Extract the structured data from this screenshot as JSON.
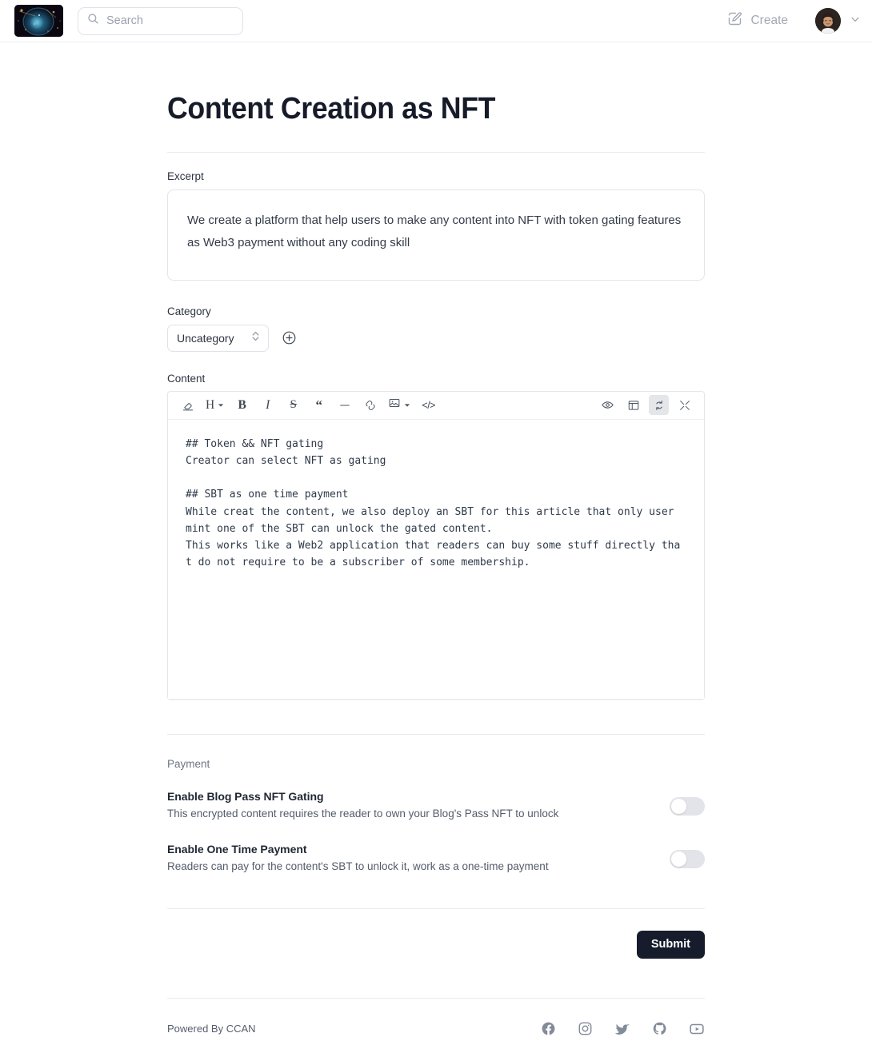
{
  "header": {
    "logo_icon": "nebula-logo-image",
    "search": {
      "placeholder": "Search",
      "value": "",
      "icon": "search-icon"
    },
    "create_label": "Create",
    "create_icon": "pencil-square-icon",
    "avatar_icon": "user-avatar-image",
    "user_chevron_icon": "chevron-down-icon"
  },
  "main": {
    "title": "Content Creation as NFT",
    "excerpt": {
      "label": "Excerpt",
      "value": "We create a platform that help users to make any content into NFT with token gating features as Web3 payment without any coding skill",
      "placeholder": "Excerpt"
    },
    "category": {
      "label": "Category",
      "selected": "Uncategory",
      "options": [
        "Uncategory"
      ],
      "stepper_icon": "chevron-up-down-icon",
      "add_icon": "plus-circle-icon"
    },
    "content": {
      "label": "Content",
      "value": "## Token && NFT gating\nCreator can select NFT as gating\n\n## SBT as one time payment\nWhile creat the content, we also deploy an SBT for this article that only user mint one of the SBT can unlock the gated content.\nThis works like a Web2 application that readers can buy some stuff directly that do not require to be a subscriber of some membership.",
      "toolbar_left": [
        {
          "name": "clear-format-icon",
          "label": "",
          "icon": "eraser-icon"
        },
        {
          "name": "heading-dropdown",
          "label": "H",
          "icon": "caret-down-icon"
        },
        {
          "name": "bold-button",
          "label": "B",
          "icon": ""
        },
        {
          "name": "italic-button",
          "label": "I",
          "icon": ""
        },
        {
          "name": "strikethrough-button",
          "label": "S",
          "icon": ""
        },
        {
          "name": "quote-button",
          "label": "“",
          "icon": ""
        },
        {
          "name": "horizontal-rule-button",
          "label": "",
          "icon": "minus-icon"
        },
        {
          "name": "link-button",
          "label": "",
          "icon": "link-icon"
        },
        {
          "name": "image-dropdown",
          "label": "",
          "icon": "image-icon"
        },
        {
          "name": "code-button",
          "label": "</>",
          "icon": ""
        }
      ],
      "toolbar_right": [
        {
          "name": "preview-toggle",
          "icon": "eye-icon",
          "active": false
        },
        {
          "name": "split-view-toggle",
          "icon": "side-panel-icon",
          "active": false
        },
        {
          "name": "sync-scroll-toggle",
          "icon": "sync-icon",
          "active": true
        },
        {
          "name": "fullscreen-toggle",
          "icon": "collapse-arrows-icon",
          "active": false
        }
      ]
    },
    "payment": {
      "section_label": "Payment",
      "toggles": [
        {
          "title": "Enable Blog Pass NFT Gating",
          "description": "This encrypted content requires the reader to own your Blog's Pass NFT to unlock",
          "enabled": false
        },
        {
          "title": "Enable One Time Payment",
          "description": "Readers can pay for the content's SBT to unlock it, work as a one-time payment",
          "enabled": false
        }
      ]
    },
    "submit_label": "Submit"
  },
  "footer": {
    "powered_by": "Powered By CCAN",
    "social": [
      {
        "name": "facebook-icon"
      },
      {
        "name": "instagram-icon"
      },
      {
        "name": "twitter-icon"
      },
      {
        "name": "github-icon"
      },
      {
        "name": "youtube-icon"
      }
    ]
  },
  "colors": {
    "accent_dark": "#161c2b",
    "border": "#e2e5ea",
    "muted_text": "#6d7584",
    "toggle_off_track": "#e3e4e9"
  }
}
